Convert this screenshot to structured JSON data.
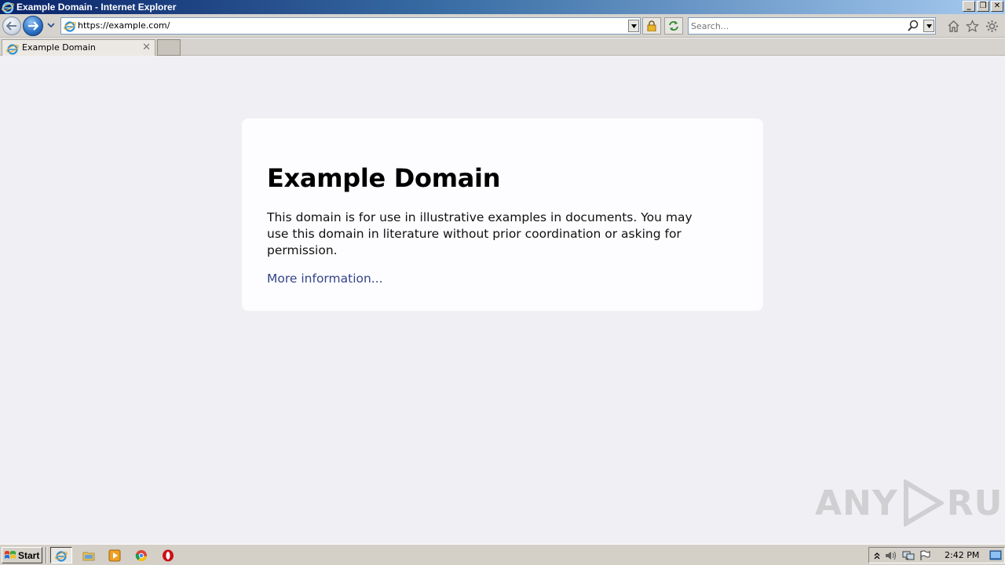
{
  "window": {
    "title": "Example Domain - Internet Explorer"
  },
  "navbar": {
    "url": "https://example.com/",
    "search_placeholder": "Search..."
  },
  "tabs": [
    {
      "label": "Example Domain",
      "active": true
    }
  ],
  "page": {
    "heading": "Example Domain",
    "paragraph": "This domain is for use in illustrative examples in documents. You may use this domain in literature without prior coordination or asking for permission.",
    "link_text": "More information..."
  },
  "watermark": {
    "left": "ANY",
    "right": "RUN"
  },
  "taskbar": {
    "start_label": "Start",
    "apps": [
      "internet-explorer",
      "file-explorer",
      "media-player",
      "chrome",
      "opera"
    ],
    "clock": "2:42 PM"
  },
  "colors": {
    "page_bg": "#f0f0f4",
    "card_bg": "#fdfdff",
    "link": "#334488",
    "title_bar_start": "#0a246a",
    "title_bar_end": "#a6caf0",
    "chrome": "#d6d3ce"
  }
}
